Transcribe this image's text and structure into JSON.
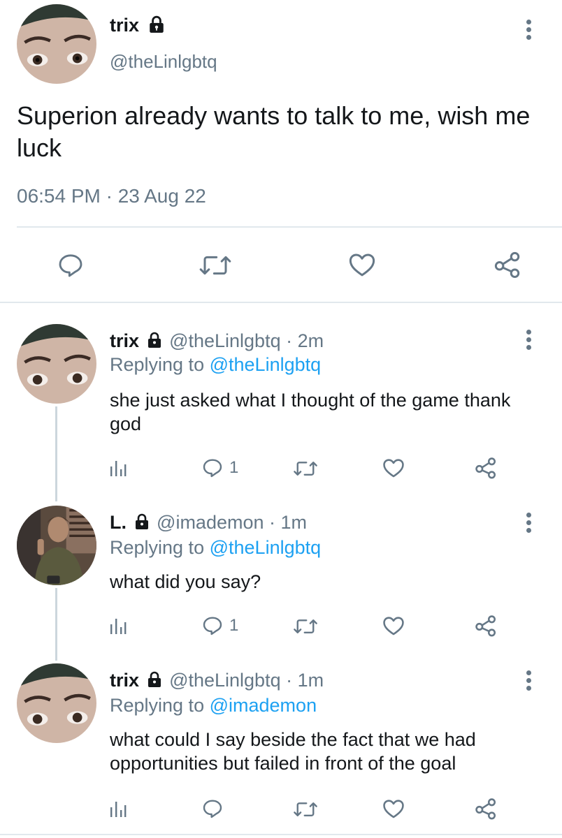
{
  "main_tweet": {
    "display_name": "trix",
    "handle": "@theLinlgbtq",
    "text": "Superion already wants to talk to me, wish me luck",
    "timestamp": "06:54 PM · 23 Aug 22",
    "actions": [
      "reply-icon",
      "retweet-icon",
      "like-icon",
      "share-icon"
    ]
  },
  "replies": [
    {
      "display_name": "trix",
      "handle": "@theLinlgbtq",
      "time": "· 2m",
      "replying_prefix": "Replying to",
      "replying_to": "@theLinlgbtq",
      "text": "she just asked what I thought of the game thank god",
      "reply_count": "1"
    },
    {
      "display_name": "L.",
      "handle": "@imademon",
      "time": "· 1m",
      "replying_prefix": "Replying to",
      "replying_to": "@theLinlgbtq",
      "text": "what did you say?",
      "reply_count": "1"
    },
    {
      "display_name": "trix",
      "handle": "@theLinlgbtq",
      "time": "· 1m",
      "replying_prefix": "Replying to",
      "replying_to": "@imademon",
      "text": "what could I say beside the fact that we had opportunities but failed in front of the goal",
      "reply_count": ""
    }
  ],
  "colors": {
    "accent": "#1da1f2",
    "muted": "#657786",
    "divider": "#e1e8ed",
    "thread_line": "#ccd6dd"
  }
}
